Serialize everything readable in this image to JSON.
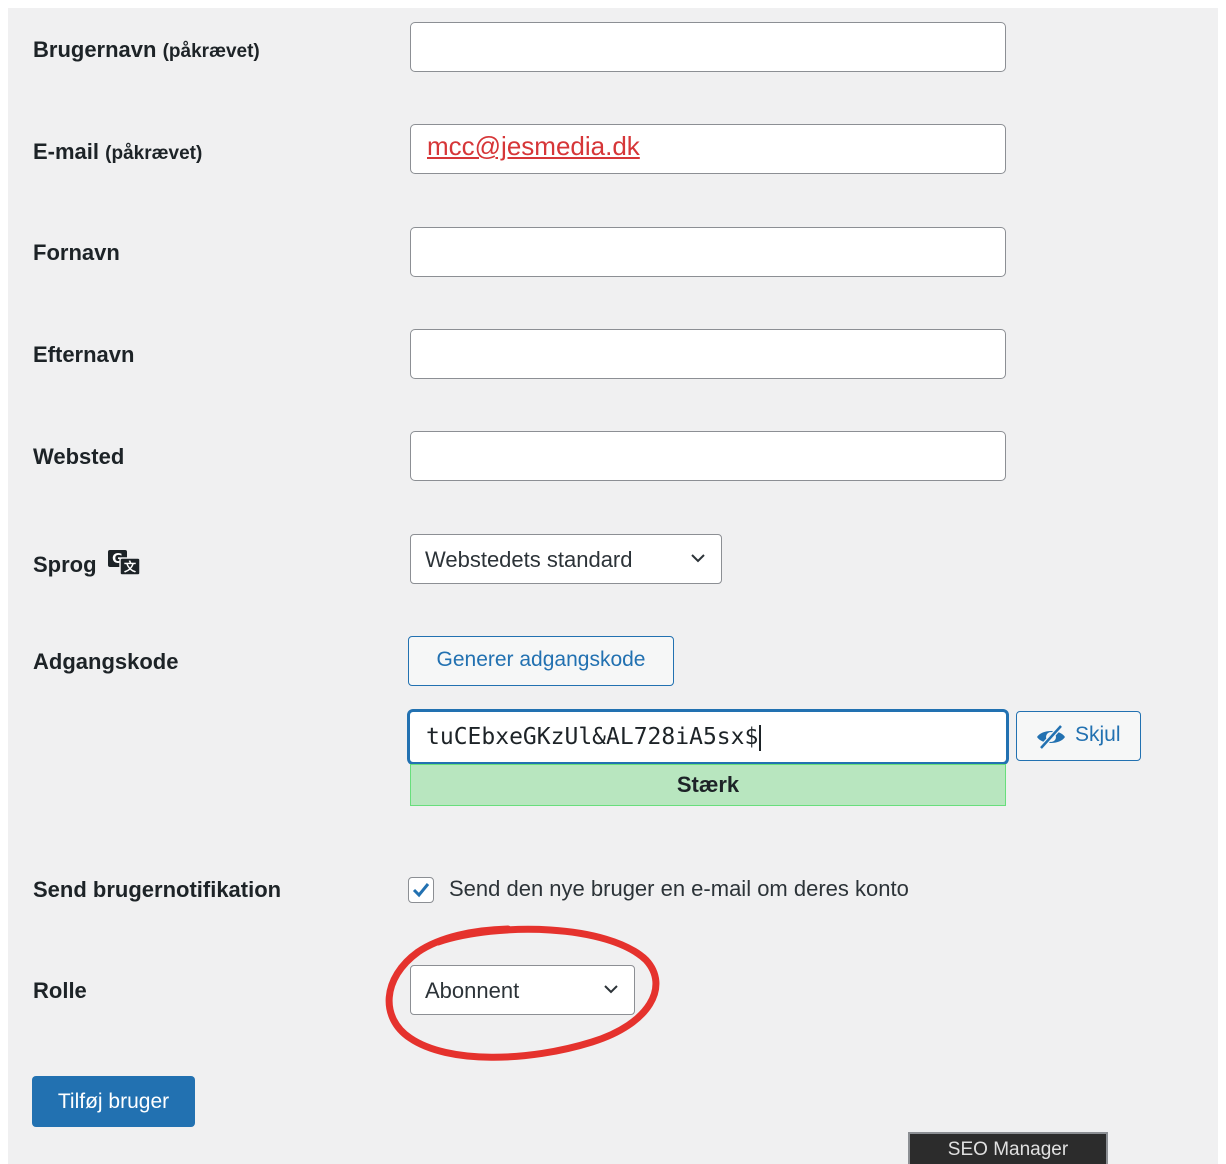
{
  "form": {
    "username": {
      "label": "Brugernavn",
      "required": "(påkrævet)",
      "value": ""
    },
    "email": {
      "label": "E-mail",
      "required": "(påkrævet)",
      "value": "mcc@jesmedia.dk"
    },
    "firstname": {
      "label": "Fornavn",
      "value": ""
    },
    "lastname": {
      "label": "Efternavn",
      "value": ""
    },
    "website": {
      "label": "Websted",
      "value": ""
    },
    "language": {
      "label": "Sprog",
      "icon": "translation-icon",
      "selected": "Webstedets standard"
    },
    "password": {
      "label": "Adgangskode",
      "generate_label": "Generer adgangskode",
      "value": "tuCEbxeGKzUl&AL728iA5sx$",
      "strength": "Stærk",
      "hide_label": "Skjul",
      "hide_icon": "eye-slash-icon"
    },
    "notification": {
      "label": "Send brugernotifikation",
      "checkbox_label": "Send den nye bruger en e-mail om deres konto",
      "checked": true
    },
    "role": {
      "label": "Rolle",
      "selected": "Abonnent"
    },
    "submit_label": "Tilføj bruger"
  },
  "overlay": {
    "seo_manager_label": "SEO Manager"
  },
  "colors": {
    "accent": "#2271b1",
    "annotation": "#e5322d",
    "strength_bg": "#b8e6bf",
    "email": "#d63638"
  }
}
